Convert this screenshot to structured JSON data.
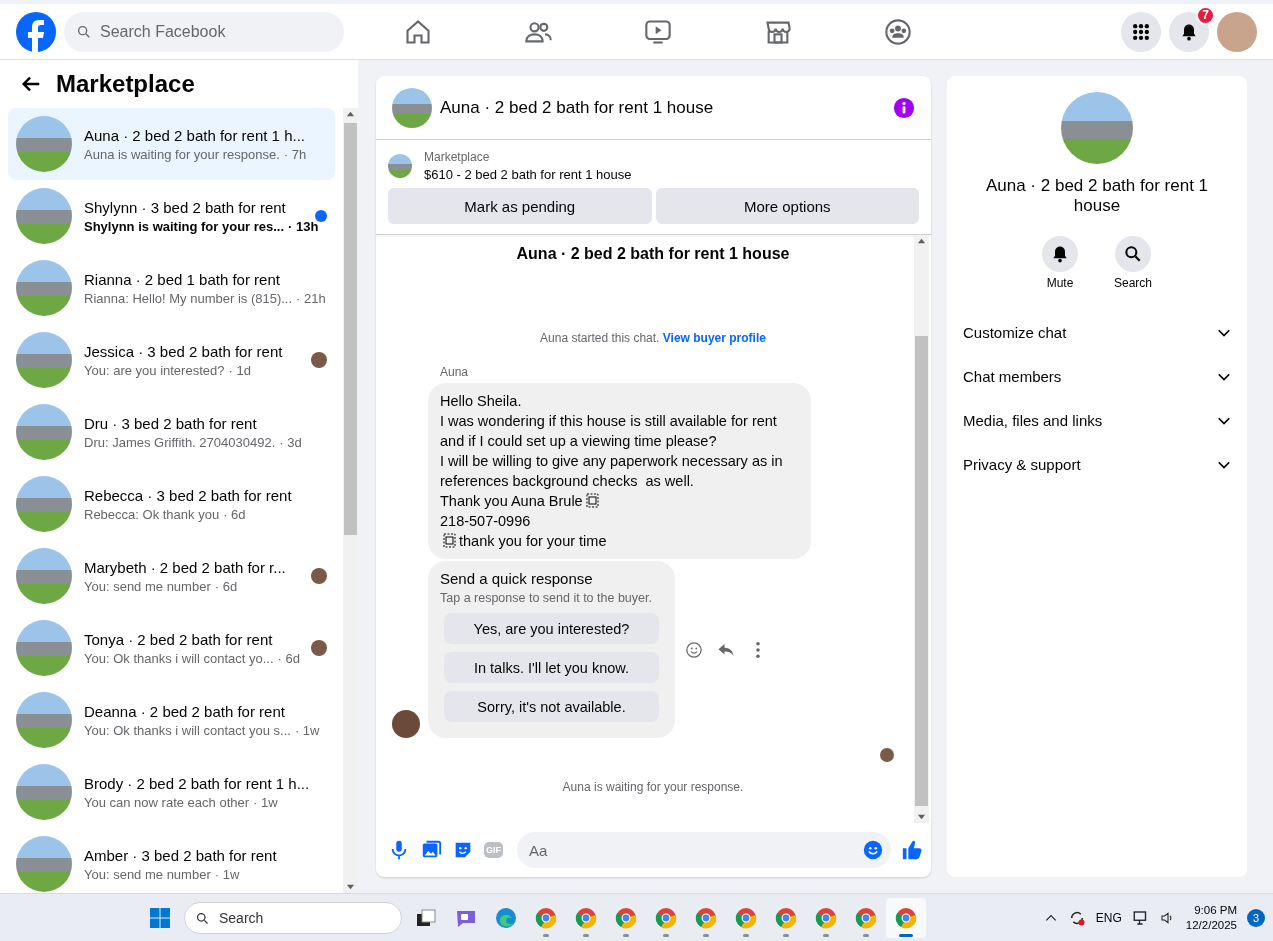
{
  "top_bar": {
    "search": {
      "placeholder": "Search Facebook"
    },
    "nav": [
      {
        "kind": "home"
      },
      {
        "kind": "friends"
      },
      {
        "kind": "video"
      },
      {
        "kind": "marketplace"
      },
      {
        "kind": "groups"
      }
    ],
    "notification_count": "7"
  },
  "sidebar": {
    "title": "Marketplace",
    "items": [
      {
        "title": "Auna · 2 bed 2 bath for rent 1 h...",
        "preview": "Auna is waiting for your response.",
        "time": "· 7h",
        "selected": true,
        "unread": false,
        "seen": false
      },
      {
        "title": "Shylynn · 3 bed 2 bath for rent",
        "preview": "Shylynn is waiting for your res...",
        "time": "· 13h",
        "selected": false,
        "unread": true,
        "seen": false
      },
      {
        "title": "Rianna · 2 bed 1 bath for rent",
        "preview": "Rianna: Hello! My number is (815)...",
        "time": "· 21h",
        "selected": false,
        "unread": false,
        "seen": false
      },
      {
        "title": "Jessica · 3 bed 2 bath for rent",
        "preview": "You: are you interested?",
        "time": "· 1d",
        "selected": false,
        "unread": false,
        "seen": true
      },
      {
        "title": "Dru · 3 bed 2 bath for rent",
        "preview": "Dru: James Griffith. 2704030492.",
        "time": "· 3d",
        "selected": false,
        "unread": false,
        "seen": false
      },
      {
        "title": "Rebecca · 3 bed 2 bath for rent",
        "preview": "Rebecca: Ok thank you",
        "time": "· 6d",
        "selected": false,
        "unread": false,
        "seen": false
      },
      {
        "title": "Marybeth · 2 bed 2 bath for r...",
        "preview": "You: send me number",
        "time": "· 6d",
        "selected": false,
        "unread": false,
        "seen": true
      },
      {
        "title": "Tonya · 2 bed 2 bath for rent",
        "preview": "You: Ok thanks i will contact yo...",
        "time": "· 6d",
        "selected": false,
        "unread": false,
        "seen": true
      },
      {
        "title": "Deanna · 2 bed 2 bath for rent",
        "preview": "You: Ok thanks i will contact you s...",
        "time": "· 1w",
        "selected": false,
        "unread": false,
        "seen": false
      },
      {
        "title": "Brody · 2 bed 2 bath for rent 1 h...",
        "preview": "You can now rate each other",
        "time": "· 1w",
        "selected": false,
        "unread": false,
        "seen": false
      },
      {
        "title": "Amber · 3 bed 2 bath for rent",
        "preview": "You: send me number",
        "time": "· 1w",
        "selected": false,
        "unread": false,
        "seen": false
      }
    ]
  },
  "chat": {
    "title": "Auna · 2 bed 2 bath for rent 1 house",
    "listing": {
      "label": "Marketplace",
      "summary": "$610 - 2 bed 2 bath for rent 1 house",
      "buttons": [
        "Mark as pending",
        "More options"
      ]
    },
    "thread_title": "Auna · 2 bed 2 bath for rent 1 house",
    "started_text": "Auna started this chat.",
    "profile_link": "View buyer profile",
    "sender": "Auna",
    "message_lines": [
      {
        "text": "Hello Sheila."
      },
      {
        "text": "I was wondering if this house is still available for rent and if I could set up a viewing time please?"
      },
      {
        "text": "I will be willing to give any paperwork necessary as in references background checks  as well."
      },
      {
        "text": "Thank you Auna Brule",
        "object_after": true
      },
      {
        "text": "218-507-0996"
      },
      {
        "text": "thank you for your time",
        "object_before": true
      }
    ],
    "quick_response": {
      "title": "Send a quick response",
      "subtitle": "Tap a response to send it to the buyer.",
      "options": [
        "Yes, are you interested?",
        "In talks. I'll let you know.",
        "Sorry, it's not available."
      ]
    },
    "status": "Auna is waiting for your response.",
    "composer": {
      "gif_label": "GIF",
      "placeholder": "Aa"
    }
  },
  "details": {
    "title": "Auna · 2 bed 2 bath for rent 1 house",
    "actions": [
      {
        "kind": "mute",
        "label": "Mute"
      },
      {
        "kind": "search",
        "label": "Search"
      }
    ],
    "sections": [
      {
        "label": "Customize chat",
        "expanded": false
      },
      {
        "label": "Chat members",
        "expanded": false
      },
      {
        "label": "Media, files and links",
        "expanded": false
      },
      {
        "label": "Privacy & support",
        "expanded": false
      }
    ]
  },
  "taskbar": {
    "search": {
      "placeholder": "Search"
    },
    "chrome_windows": [
      {
        "selected": false
      },
      {
        "selected": false
      },
      {
        "selected": false
      },
      {
        "selected": false
      },
      {
        "selected": false
      },
      {
        "selected": false
      },
      {
        "selected": false
      },
      {
        "selected": false
      },
      {
        "selected": false
      },
      {
        "selected": true
      }
    ],
    "language": "ENG",
    "time": "9:06 PM",
    "date": "12/2/2025",
    "notification_count": "3"
  }
}
